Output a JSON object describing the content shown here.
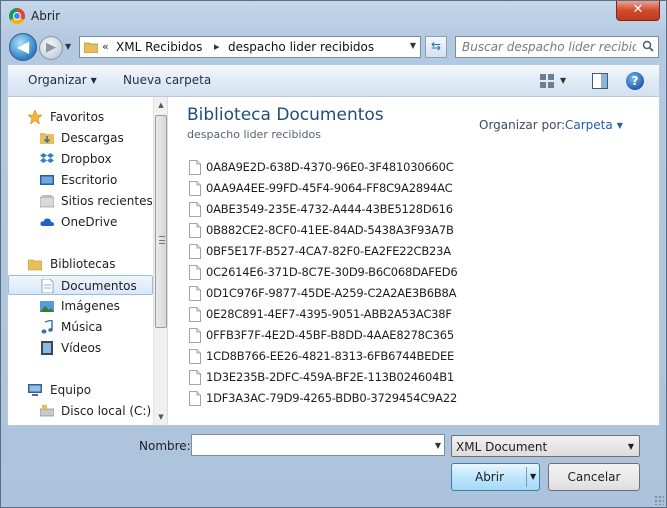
{
  "window": {
    "title": "Abrir",
    "close_symbol": "✕"
  },
  "nav": {
    "back_symbol": "◀",
    "forward_symbol": "▶",
    "address_prefix": "«",
    "breadcrumbs": [
      "XML Recibidos",
      "despacho lider recibidos"
    ],
    "search_placeholder": "Buscar despacho lider recibidos"
  },
  "toolbar": {
    "organize_label": "Organizar",
    "new_folder_label": "Nueva carpeta",
    "help_symbol": "?"
  },
  "sidebar": {
    "favorites_label": "Favoritos",
    "favorites": [
      "Descargas",
      "Dropbox",
      "Escritorio",
      "Sitios recientes",
      "OneDrive"
    ],
    "libraries_label": "Bibliotecas",
    "libraries": [
      "Documentos",
      "Imágenes",
      "Música",
      "Vídeos"
    ],
    "selected": "Documentos",
    "computer_label": "Equipo",
    "computer": [
      "Disco local (C:)"
    ]
  },
  "main": {
    "library_title": "Biblioteca Documentos",
    "library_subtitle": "despacho lider recibidos",
    "arrange_by_label": "Organizar por:",
    "arrange_by_value": "Carpeta"
  },
  "files": [
    "0A8A9E2D-638D-4370-96E0-3F481030660C",
    "0AA9A4EE-99FD-45F4-9064-FF8C9A2894AC",
    "0ABE3549-235E-4732-A444-43BE5128D616",
    "0B882CE2-8CF0-41EE-84AD-5438A3F93A7B",
    "0BF5E17F-B527-4CA7-82F0-EA2FE22CB23A",
    "0C2614E6-371D-8C7E-30D9-B6C068DAFED6",
    "0D1C976F-9877-45DE-A259-C2A2AE3B6B8A",
    "0E28C891-4EF7-4395-9051-ABB2A53AC38F",
    "0FFB3F7F-4E2D-45BF-B8DD-4AAE8278C365",
    "1CD8B766-EE26-4821-8313-6FB6744BEDEE",
    "1D3E235B-2DFC-459A-BF2E-113B024604B1",
    "1DF3A3AC-79D9-4265-BDB0-3729454C9A22"
  ],
  "footer": {
    "name_label": "Nombre:",
    "name_value": "",
    "file_type": "XML Document",
    "open_label": "Abrir",
    "cancel_label": "Cancelar"
  },
  "colors": {
    "accent": "#1e4e79",
    "link": "#1f5ea8",
    "selection": "#d9e8fa"
  }
}
